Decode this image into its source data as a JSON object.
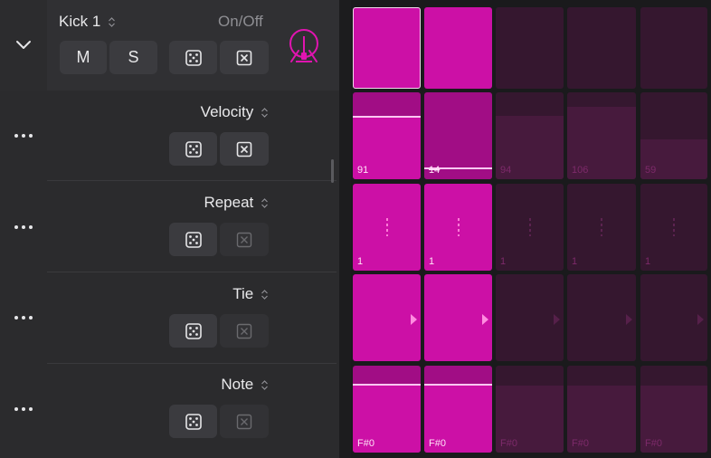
{
  "track": {
    "name": "Kick 1",
    "onoff_label": "On/Off",
    "mute_label": "M",
    "solo_label": "S"
  },
  "rows": [
    {
      "label": "Velocity"
    },
    {
      "label": "Repeat"
    },
    {
      "label": "Tie"
    },
    {
      "label": "Note"
    }
  ],
  "colors": {
    "accent": "#cc10a6",
    "active_dim": "#a10d85",
    "inactive": "#35172f",
    "inactive_fill": "#471a3d"
  },
  "steps": {
    "on": [
      {
        "value": ""
      },
      {
        "value": ""
      }
    ],
    "velocity": [
      {
        "value": "91",
        "level": 0.71
      },
      {
        "value": "14",
        "level": 0.11
      },
      {
        "value": "94",
        "level": 0.73
      },
      {
        "value": "106",
        "level": 0.83
      },
      {
        "value": "59",
        "level": 0.46
      }
    ],
    "repeat": [
      {
        "value": "1"
      },
      {
        "value": "1"
      },
      {
        "value": "1"
      },
      {
        "value": "1"
      },
      {
        "value": "1"
      }
    ],
    "note": [
      {
        "value": "F#0"
      },
      {
        "value": "F#0"
      },
      {
        "value": "F#0"
      },
      {
        "value": "F#0"
      },
      {
        "value": "F#0"
      }
    ]
  }
}
